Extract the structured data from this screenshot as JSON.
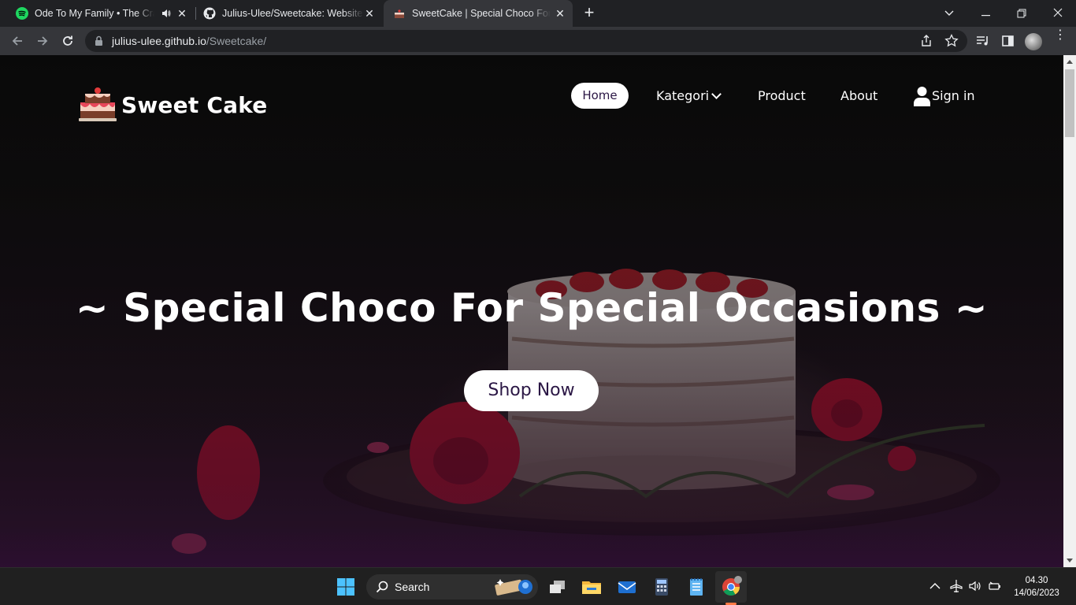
{
  "browser": {
    "tabs": [
      {
        "title": "Ode To My Family • The Cranberries",
        "favicon": "spotify-icon",
        "audio": true
      },
      {
        "title": "Julius-Ulee/Sweetcake: Website in HTML",
        "favicon": "github-icon"
      },
      {
        "title": "SweetCake | Special Choco For Special Occasions",
        "favicon": "cake-icon",
        "active": true
      }
    ],
    "url_host": "julius-ulee.github.io",
    "url_path": "/Sweetcake/"
  },
  "site": {
    "brand": "Sweet Cake",
    "nav": {
      "home": "Home",
      "kategori": "Kategori",
      "product": "Product",
      "about": "About",
      "signin": "Sign in"
    },
    "hero_title": "~ Special Choco For Special Occasions ~",
    "cta": "Shop Now",
    "accent_color": "#2b1745"
  },
  "taskbar": {
    "search_label": "Search",
    "time": "04.30",
    "date": "14/06/2023"
  }
}
